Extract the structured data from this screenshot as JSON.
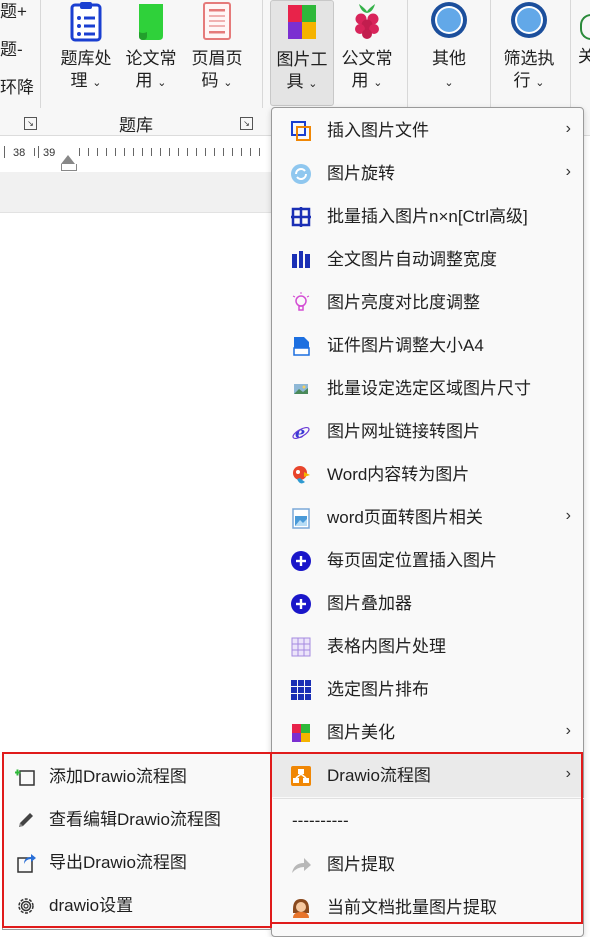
{
  "ribbon": {
    "left_fragments": [
      "题+",
      "题-",
      "环降"
    ],
    "buttons": [
      {
        "line1": "题库处",
        "line2": "理",
        "chevron": "⌄",
        "icon": "clipboard-icon"
      },
      {
        "line1": "论文常",
        "line2": "用",
        "chevron": "⌄",
        "icon": "green-scroll-icon"
      },
      {
        "line1": "页眉页",
        "line2": "码",
        "chevron": "⌄",
        "icon": "page-header-icon"
      },
      {
        "line1": "图片工",
        "line2": "具",
        "chevron": "⌄",
        "icon": "picture-tools-icon"
      },
      {
        "line1": "公文常",
        "line2": "用",
        "chevron": "⌄",
        "icon": "raspberry-icon"
      },
      {
        "line1": "其他",
        "line2": "",
        "chevron": "⌄",
        "icon": "blue-circle-icon"
      },
      {
        "line1": "筛选执",
        "line2": "行",
        "chevron": "⌄",
        "icon": "blue-circle-icon"
      },
      {
        "line1": "关",
        "line2": "",
        "chevron": "",
        "icon": "partial-icon"
      }
    ],
    "group_label": "题库",
    "launcher_glyph": "↘"
  },
  "ruler": {
    "labels": [
      "38",
      "39"
    ]
  },
  "menu": {
    "items": [
      {
        "label": "插入图片文件",
        "icon": "insert-picture-icon",
        "has_submenu": true
      },
      {
        "label": "图片旋转",
        "icon": "rotate-icon",
        "has_submenu": true
      },
      {
        "label": "批量插入图片n×n[Ctrl高级]",
        "icon": "grid-insert-icon",
        "has_submenu": false
      },
      {
        "label": "全文图片自动调整宽度",
        "icon": "columns-icon",
        "has_submenu": false
      },
      {
        "label": "图片亮度对比度调整",
        "icon": "lightbulb-icon",
        "has_submenu": false
      },
      {
        "label": "证件图片调整大小A4",
        "icon": "document-icon",
        "has_submenu": false
      },
      {
        "label": "批量设定选定区域图片尺寸",
        "icon": "image-thumb-icon",
        "has_submenu": false
      },
      {
        "label": "图片网址链接转图片",
        "icon": "ie-icon",
        "has_submenu": false
      },
      {
        "label": "Word内容转为图片",
        "icon": "parrot-icon",
        "has_submenu": false
      },
      {
        "label": "word页面转图片相关",
        "icon": "word-page-icon",
        "has_submenu": true
      },
      {
        "label": "每页固定位置插入图片",
        "icon": "plus-circle-icon",
        "has_submenu": false
      },
      {
        "label": "图片叠加器",
        "icon": "plus-circle-icon",
        "has_submenu": false
      },
      {
        "label": "表格内图片处理",
        "icon": "table-grid-icon",
        "has_submenu": false
      },
      {
        "label": "选定图片排布",
        "icon": "layout-grid-icon",
        "has_submenu": false
      },
      {
        "label": "图片美化",
        "icon": "colorful-squares-icon",
        "has_submenu": true
      },
      {
        "label": "Drawio流程图",
        "icon": "drawio-icon",
        "has_submenu": true
      },
      {
        "label": "----------",
        "icon": "",
        "has_submenu": false
      },
      {
        "label": "图片提取",
        "icon": "share-arrow-icon",
        "has_submenu": false
      },
      {
        "label": "当前文档批量图片提取",
        "icon": "person-icon",
        "has_submenu": false
      }
    ],
    "arrow_glyph": "›"
  },
  "submenu": {
    "items": [
      {
        "label": "添加Drawio流程图",
        "icon": "add-frame-icon"
      },
      {
        "label": "查看编辑Drawio流程图",
        "icon": "pencil-icon"
      },
      {
        "label": "导出Drawio流程图",
        "icon": "export-icon"
      },
      {
        "label": "drawio设置",
        "icon": "gear-icon"
      }
    ]
  },
  "colors": {
    "highlight_border": "#e01b1b",
    "drawio_orange": "#f08705",
    "accent_blue": "#1a3fd1"
  }
}
